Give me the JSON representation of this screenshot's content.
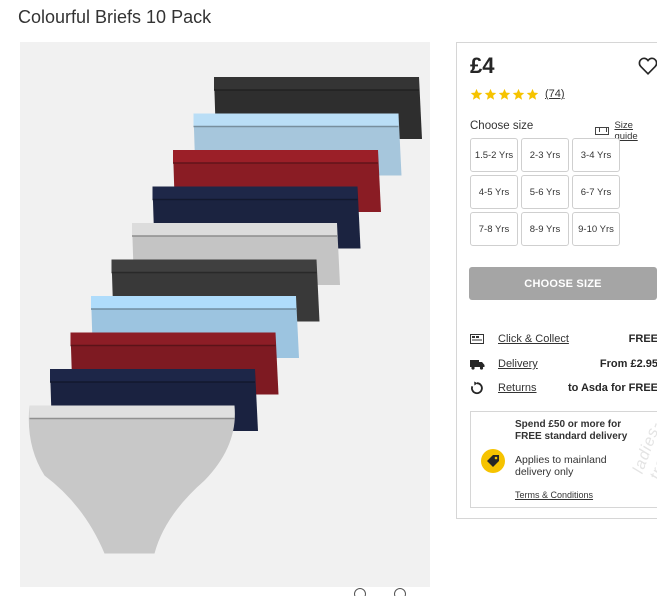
{
  "product": {
    "title": "Colourful Briefs 10 Pack",
    "price": "£4",
    "reviews_count": "(74)",
    "rating": 5,
    "max_rating": 5
  },
  "size_section": {
    "label": "Choose size",
    "guide_label": "Size guide",
    "options": [
      "1.5-2 Yrs",
      "2-3 Yrs",
      "3-4 Yrs",
      "4-5 Yrs",
      "5-6 Yrs",
      "6-7 Yrs",
      "7-8 Yrs",
      "8-9 Yrs",
      "9-10 Yrs"
    ]
  },
  "cta": {
    "choose_size": "CHOOSE SIZE"
  },
  "delivery": [
    {
      "icon": "store-icon",
      "label": "Click & Collect",
      "value": "FREE"
    },
    {
      "icon": "truck-icon",
      "label": "Delivery",
      "value": "From £2.95"
    },
    {
      "icon": "returns-icon",
      "label": "Returns",
      "value": "to Asda for FREE"
    }
  ],
  "promo": {
    "headline": "Spend £50 or more for FREE standard delivery",
    "sub": "Applies to mainland delivery only",
    "terms": "Terms & Conditions"
  },
  "watermark": "ladies-trap.ru",
  "colors": {
    "accent_star": "#f6c300",
    "button_disabled": "#a5a5a5",
    "brief_colors": [
      "#2e2e2e",
      "#a6c6dc",
      "#8a1c24",
      "#1b2340",
      "#c4c4c4",
      "#393939",
      "#9cc4e0",
      "#7e1a22",
      "#1a2240",
      "#c8c8c8"
    ]
  }
}
